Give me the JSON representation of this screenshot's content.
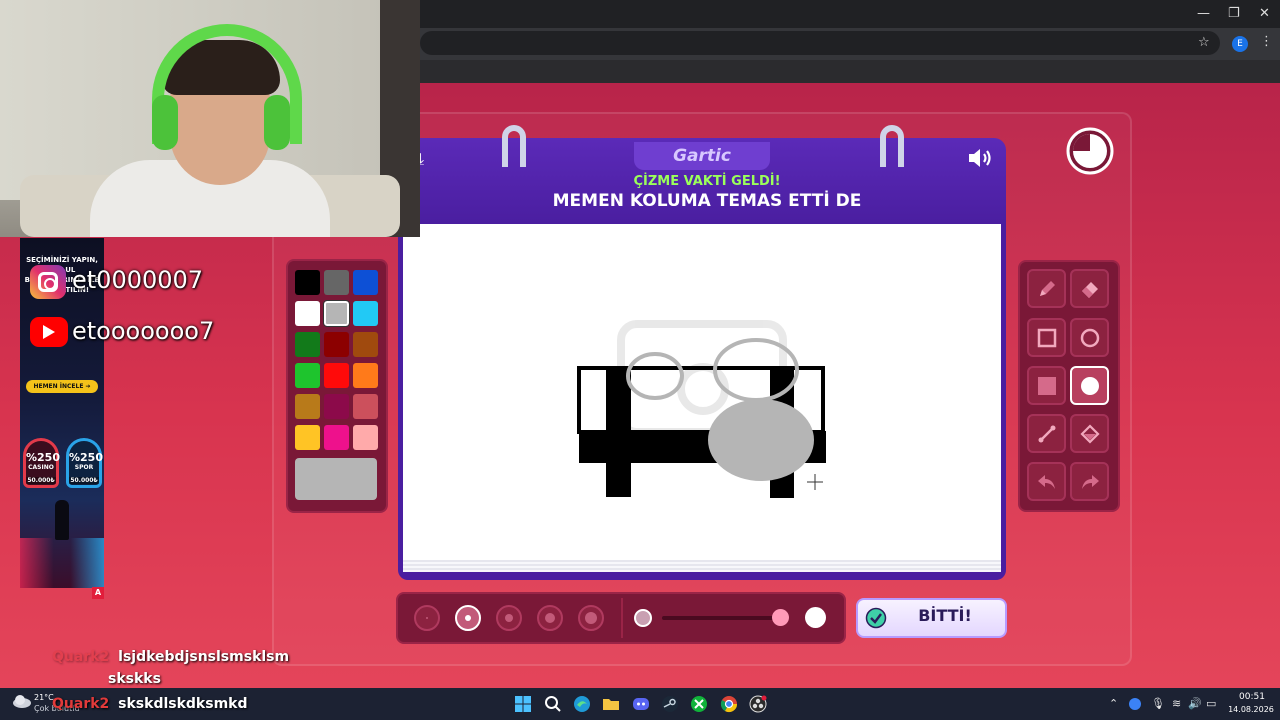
{
  "browser": {
    "window_controls": [
      "—",
      "❐",
      "✕"
    ],
    "profile_initial": "E"
  },
  "social": {
    "instagram_handle": "et0000007",
    "youtube_handle": "etooooooo7"
  },
  "ad": {
    "headline": "SEÇİMİNİZİ YAPIN, MALUL BONUSLARIMIZ İLE BİZE KATILIN!",
    "cta": "HEMEN İNCELE ➔",
    "casino_pct": "%250",
    "casino_label": "CASINO",
    "casino_amount": "50.000₺",
    "spor_pct": "%250",
    "spor_label": "SPOR",
    "spor_amount": "50.000₺",
    "corner_badge": "A"
  },
  "game": {
    "logo": "Gartic",
    "phase": "ÇİZME VAKTİ GELDİ!",
    "prompt": "MEMEN KOLUMA TEMAS ETTİ DE",
    "done_label": "BİTTİ!",
    "timer_remaining_fraction": 0.75
  },
  "palette": {
    "colors": [
      "#000000",
      "#666666",
      "#0d50d6",
      "#ffffff",
      "#b5b5b5",
      "#22c9f5",
      "#127a1a",
      "#8c0000",
      "#a04a0e",
      "#1ec42d",
      "#ff0a0a",
      "#ff7a1a",
      "#b87a1a",
      "#8c0a4a",
      "#cc505c",
      "#ffc425",
      "#ee118c",
      "#ffaaaa"
    ],
    "selected": "#b5b5b5",
    "current": "#b5b5b5"
  },
  "tools": [
    "pencil-icon",
    "eraser-icon",
    "square-outline-icon",
    "circle-outline-icon",
    "square-filled-icon",
    "circle-filled-icon",
    "line-icon",
    "fill-bucket-icon",
    "undo-icon",
    "redo-icon"
  ],
  "tools_selected": "circle-filled-icon",
  "brush": {
    "sizes": 5,
    "selected_size_index": 1,
    "opacity_fraction": 0.95
  },
  "chat": [
    {
      "user": "Quark2",
      "message": "lsjdkebdjsnslsmsklsm"
    },
    {
      "user": "",
      "message": "skskks"
    },
    {
      "user": "Quark2",
      "message": "skskdlskdksmkd"
    }
  ],
  "taskbar": {
    "weather_temp": "21°C",
    "weather_desc": "Çok bulutlu",
    "time": "00:51",
    "date": "14.08.2026"
  },
  "colors": {
    "header_purple": "#4a1ea0",
    "panel": "#7a1837",
    "accent_green": "#9bff5a"
  }
}
